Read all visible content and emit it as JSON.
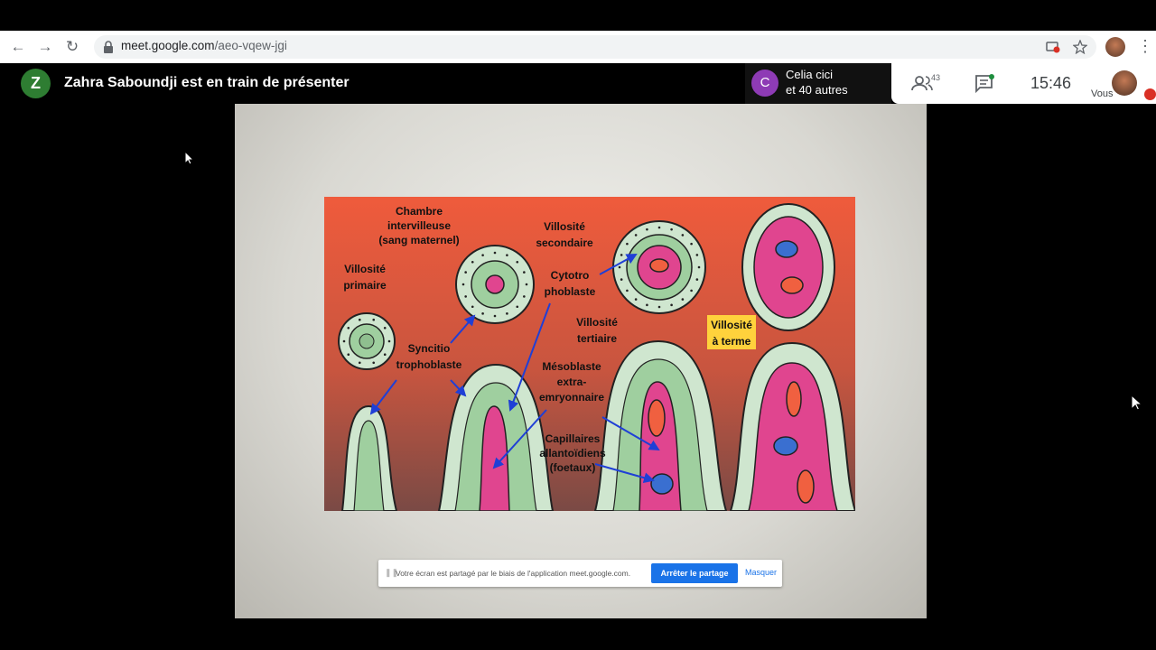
{
  "browser": {
    "url_host": "meet.google.com",
    "url_path": "/aeo-vqew-jgi",
    "icons": [
      "back-icon",
      "forward-icon",
      "reload-icon",
      "lock-icon",
      "cast-icon",
      "star-icon",
      "profile-avatar",
      "more-icon"
    ]
  },
  "meet": {
    "presenter_initial": "Z",
    "presenter_text": "Zahra Saboundji est en train de présenter",
    "chip_initial": "C",
    "chip_line1": "Celia cici",
    "chip_line2": "et 40 autres",
    "people_count": "43",
    "time": "15:46",
    "self_label": "Vous",
    "colors": {
      "presenter_avatar": "#2e7d32",
      "chip_avatar": "#8e3bb5",
      "accent": "#1a73e8"
    }
  },
  "slide": {
    "labels": {
      "chambre": [
        "Chambre",
        "intervilleuse",
        "(sang maternel)"
      ],
      "primaire": [
        "Villosité",
        "primaire"
      ],
      "secondaire": [
        "Villosité",
        "secondaire"
      ],
      "cytotro": [
        "Cytotro",
        "phoblaste"
      ],
      "syncitio": [
        "Syncitio",
        "trophoblaste"
      ],
      "tertiaire": [
        "Villosité",
        "tertiaire"
      ],
      "terme": [
        "Villosité",
        "à terme"
      ],
      "mesoblaste": [
        "Mésoblaste",
        "extra-",
        "emryonnaire"
      ],
      "capillaires": [
        "Capillaires",
        "allantoïdiens",
        "(foetaux)"
      ]
    }
  },
  "share_bar": {
    "message": "Votre écran est partagé par le biais de l'application meet.google.com.",
    "stop_label": "Arrêter le partage",
    "hide_label": "Masquer"
  }
}
